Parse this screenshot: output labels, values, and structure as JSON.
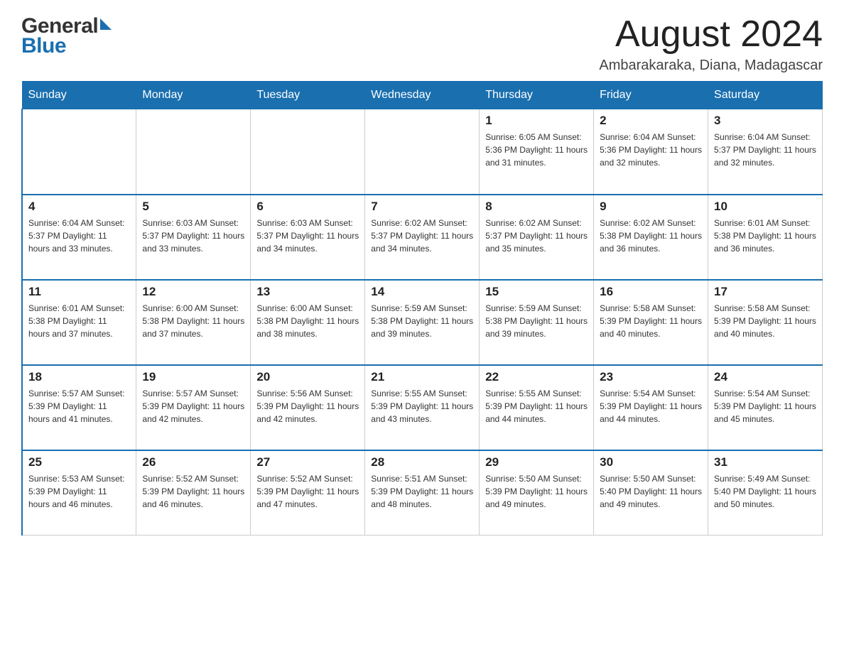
{
  "header": {
    "logo_text_general": "General",
    "logo_text_blue": "Blue",
    "month_title": "August 2024",
    "location": "Ambarakaraka, Diana, Madagascar"
  },
  "weekdays": [
    "Sunday",
    "Monday",
    "Tuesday",
    "Wednesday",
    "Thursday",
    "Friday",
    "Saturday"
  ],
  "weeks": [
    [
      {
        "day": "",
        "info": ""
      },
      {
        "day": "",
        "info": ""
      },
      {
        "day": "",
        "info": ""
      },
      {
        "day": "",
        "info": ""
      },
      {
        "day": "1",
        "info": "Sunrise: 6:05 AM\nSunset: 5:36 PM\nDaylight: 11 hours\nand 31 minutes."
      },
      {
        "day": "2",
        "info": "Sunrise: 6:04 AM\nSunset: 5:36 PM\nDaylight: 11 hours\nand 32 minutes."
      },
      {
        "day": "3",
        "info": "Sunrise: 6:04 AM\nSunset: 5:37 PM\nDaylight: 11 hours\nand 32 minutes."
      }
    ],
    [
      {
        "day": "4",
        "info": "Sunrise: 6:04 AM\nSunset: 5:37 PM\nDaylight: 11 hours\nand 33 minutes."
      },
      {
        "day": "5",
        "info": "Sunrise: 6:03 AM\nSunset: 5:37 PM\nDaylight: 11 hours\nand 33 minutes."
      },
      {
        "day": "6",
        "info": "Sunrise: 6:03 AM\nSunset: 5:37 PM\nDaylight: 11 hours\nand 34 minutes."
      },
      {
        "day": "7",
        "info": "Sunrise: 6:02 AM\nSunset: 5:37 PM\nDaylight: 11 hours\nand 34 minutes."
      },
      {
        "day": "8",
        "info": "Sunrise: 6:02 AM\nSunset: 5:37 PM\nDaylight: 11 hours\nand 35 minutes."
      },
      {
        "day": "9",
        "info": "Sunrise: 6:02 AM\nSunset: 5:38 PM\nDaylight: 11 hours\nand 36 minutes."
      },
      {
        "day": "10",
        "info": "Sunrise: 6:01 AM\nSunset: 5:38 PM\nDaylight: 11 hours\nand 36 minutes."
      }
    ],
    [
      {
        "day": "11",
        "info": "Sunrise: 6:01 AM\nSunset: 5:38 PM\nDaylight: 11 hours\nand 37 minutes."
      },
      {
        "day": "12",
        "info": "Sunrise: 6:00 AM\nSunset: 5:38 PM\nDaylight: 11 hours\nand 37 minutes."
      },
      {
        "day": "13",
        "info": "Sunrise: 6:00 AM\nSunset: 5:38 PM\nDaylight: 11 hours\nand 38 minutes."
      },
      {
        "day": "14",
        "info": "Sunrise: 5:59 AM\nSunset: 5:38 PM\nDaylight: 11 hours\nand 39 minutes."
      },
      {
        "day": "15",
        "info": "Sunrise: 5:59 AM\nSunset: 5:38 PM\nDaylight: 11 hours\nand 39 minutes."
      },
      {
        "day": "16",
        "info": "Sunrise: 5:58 AM\nSunset: 5:39 PM\nDaylight: 11 hours\nand 40 minutes."
      },
      {
        "day": "17",
        "info": "Sunrise: 5:58 AM\nSunset: 5:39 PM\nDaylight: 11 hours\nand 40 minutes."
      }
    ],
    [
      {
        "day": "18",
        "info": "Sunrise: 5:57 AM\nSunset: 5:39 PM\nDaylight: 11 hours\nand 41 minutes."
      },
      {
        "day": "19",
        "info": "Sunrise: 5:57 AM\nSunset: 5:39 PM\nDaylight: 11 hours\nand 42 minutes."
      },
      {
        "day": "20",
        "info": "Sunrise: 5:56 AM\nSunset: 5:39 PM\nDaylight: 11 hours\nand 42 minutes."
      },
      {
        "day": "21",
        "info": "Sunrise: 5:55 AM\nSunset: 5:39 PM\nDaylight: 11 hours\nand 43 minutes."
      },
      {
        "day": "22",
        "info": "Sunrise: 5:55 AM\nSunset: 5:39 PM\nDaylight: 11 hours\nand 44 minutes."
      },
      {
        "day": "23",
        "info": "Sunrise: 5:54 AM\nSunset: 5:39 PM\nDaylight: 11 hours\nand 44 minutes."
      },
      {
        "day": "24",
        "info": "Sunrise: 5:54 AM\nSunset: 5:39 PM\nDaylight: 11 hours\nand 45 minutes."
      }
    ],
    [
      {
        "day": "25",
        "info": "Sunrise: 5:53 AM\nSunset: 5:39 PM\nDaylight: 11 hours\nand 46 minutes."
      },
      {
        "day": "26",
        "info": "Sunrise: 5:52 AM\nSunset: 5:39 PM\nDaylight: 11 hours\nand 46 minutes."
      },
      {
        "day": "27",
        "info": "Sunrise: 5:52 AM\nSunset: 5:39 PM\nDaylight: 11 hours\nand 47 minutes."
      },
      {
        "day": "28",
        "info": "Sunrise: 5:51 AM\nSunset: 5:39 PM\nDaylight: 11 hours\nand 48 minutes."
      },
      {
        "day": "29",
        "info": "Sunrise: 5:50 AM\nSunset: 5:39 PM\nDaylight: 11 hours\nand 49 minutes."
      },
      {
        "day": "30",
        "info": "Sunrise: 5:50 AM\nSunset: 5:40 PM\nDaylight: 11 hours\nand 49 minutes."
      },
      {
        "day": "31",
        "info": "Sunrise: 5:49 AM\nSunset: 5:40 PM\nDaylight: 11 hours\nand 50 minutes."
      }
    ]
  ]
}
